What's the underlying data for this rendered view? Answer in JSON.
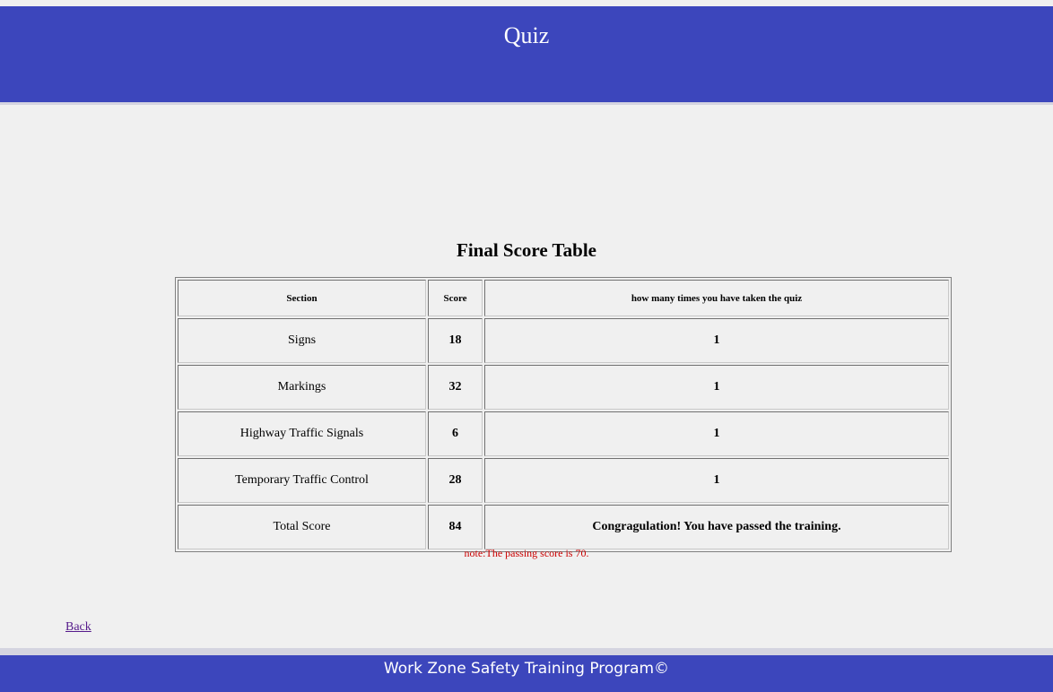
{
  "header": {
    "title": "Quiz"
  },
  "main": {
    "table_title": "Final Score Table",
    "table": {
      "columns": [
        "Section",
        "Score",
        "how many times you have taken the quiz"
      ],
      "rows": [
        {
          "section": "Signs",
          "score": "18",
          "times": "1"
        },
        {
          "section": "Markings",
          "score": "32",
          "times": "1"
        },
        {
          "section": "Highway Traffic Signals",
          "score": "6",
          "times": "1"
        },
        {
          "section": "Temporary Traffic Control",
          "score": "28",
          "times": "1"
        },
        {
          "section": "Total Score",
          "score": "84",
          "times": "Congragulation! You have passed the training."
        }
      ]
    },
    "note": "note:The passing score is 70.",
    "back_label": "Back"
  },
  "footer": {
    "text": "Work Zone Safety Training Program©"
  },
  "colors": {
    "header_bg": "#3c46bc",
    "note_text": "#cc0000",
    "link": "#551a8b"
  }
}
